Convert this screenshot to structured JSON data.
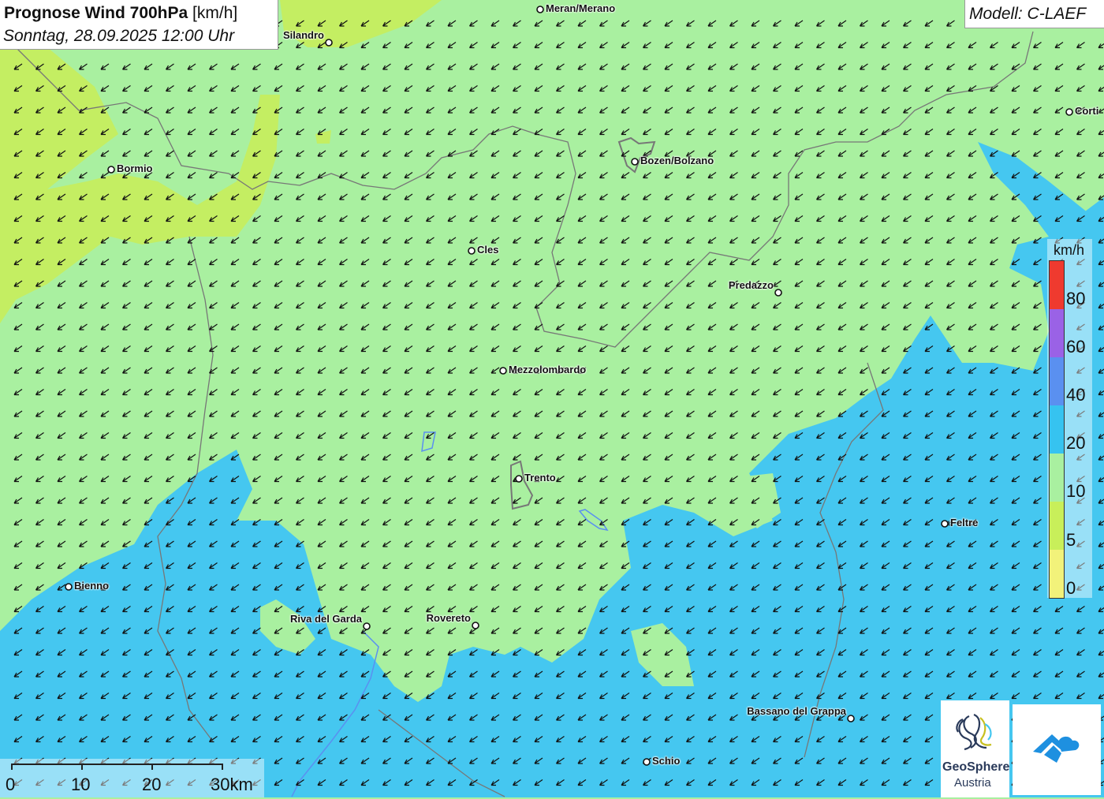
{
  "header": {
    "title_bold": "Prognose Wind 700hPa",
    "title_unit": "[km/h]",
    "datetime": "Sonntag, 28.09.2025 12:00 Uhr"
  },
  "model": "Modell: C-LAEF",
  "legend": {
    "unit": "km/h",
    "labels": [
      "80",
      "60",
      "40",
      "20",
      "10",
      "5",
      "0"
    ],
    "colors": [
      "#ef3a2f",
      "#9a62e6",
      "#5a90f0",
      "#36c3f0",
      "#a9f0a0",
      "#c8ef5a",
      "#f2f27a"
    ]
  },
  "scale_bar": {
    "labels": [
      "0",
      "10",
      "20",
      "30km"
    ]
  },
  "cities": [
    {
      "name": "Meran/Merano"
    },
    {
      "name": "Silandro"
    },
    {
      "name": "Bormio"
    },
    {
      "name": "Bozen/Bolzano"
    },
    {
      "name": "Cles"
    },
    {
      "name": "Predazzo"
    },
    {
      "name": "Mezzolombardo"
    },
    {
      "name": "Trento"
    },
    {
      "name": "Feltre"
    },
    {
      "name": "Bienno"
    },
    {
      "name": "Riva del Garda"
    },
    {
      "name": "Rovereto"
    },
    {
      "name": "Bassano del Grappa"
    },
    {
      "name": "Schio"
    },
    {
      "name": "Corti"
    }
  ],
  "logos": {
    "geosphere_line1": "GeoSphere",
    "geosphere_line2": "Austria"
  },
  "wind_direction": "north-east to south-west"
}
